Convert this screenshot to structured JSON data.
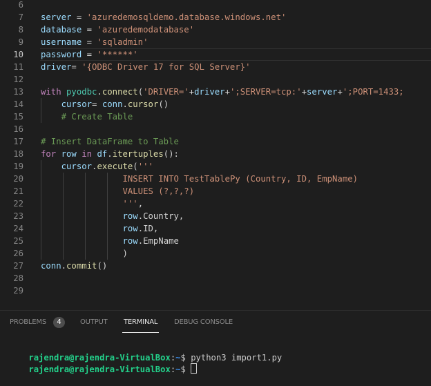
{
  "editor": {
    "active_line": 10,
    "lines": [
      {
        "n": "6",
        "tokens": []
      },
      {
        "n": "7",
        "tokens": [
          {
            "t": "server",
            "c": "var"
          },
          {
            "t": " = ",
            "c": "op"
          },
          {
            "t": "'azuredemosqldemo.database.windows.net'",
            "c": "str"
          }
        ]
      },
      {
        "n": "8",
        "tokens": [
          {
            "t": "database",
            "c": "var"
          },
          {
            "t": " = ",
            "c": "op"
          },
          {
            "t": "'azuredemodatabase'",
            "c": "str"
          }
        ]
      },
      {
        "n": "9",
        "tokens": [
          {
            "t": "username",
            "c": "var"
          },
          {
            "t": " = ",
            "c": "op"
          },
          {
            "t": "'sqladmin'",
            "c": "str"
          }
        ]
      },
      {
        "n": "10",
        "tokens": [
          {
            "t": "password",
            "c": "var"
          },
          {
            "t": " = ",
            "c": "op"
          },
          {
            "t": "'******'",
            "c": "str"
          }
        ]
      },
      {
        "n": "11",
        "tokens": [
          {
            "t": "driver",
            "c": "var"
          },
          {
            "t": "= ",
            "c": "op"
          },
          {
            "t": "'{ODBC Driver 17 for SQL Server}'",
            "c": "str"
          }
        ]
      },
      {
        "n": "12",
        "tokens": []
      },
      {
        "n": "13",
        "tokens": [
          {
            "t": "with ",
            "c": "kw"
          },
          {
            "t": "pyodbc",
            "c": "fn"
          },
          {
            "t": ".",
            "c": "op"
          },
          {
            "t": "connect",
            "c": "meth"
          },
          {
            "t": "(",
            "c": "op"
          },
          {
            "t": "'DRIVER='",
            "c": "str"
          },
          {
            "t": "+",
            "c": "op"
          },
          {
            "t": "driver",
            "c": "var"
          },
          {
            "t": "+",
            "c": "op"
          },
          {
            "t": "';SERVER=tcp:'",
            "c": "str"
          },
          {
            "t": "+",
            "c": "op"
          },
          {
            "t": "server",
            "c": "var"
          },
          {
            "t": "+",
            "c": "op"
          },
          {
            "t": "';PORT=1433;",
            "c": "str"
          }
        ]
      },
      {
        "n": "14",
        "tokens": [
          {
            "t": "    ",
            "c": "op"
          },
          {
            "t": "cursor",
            "c": "var"
          },
          {
            "t": "= ",
            "c": "op"
          },
          {
            "t": "conn",
            "c": "var"
          },
          {
            "t": ".",
            "c": "op"
          },
          {
            "t": "cursor",
            "c": "meth"
          },
          {
            "t": "()",
            "c": "op"
          }
        ]
      },
      {
        "n": "15",
        "tokens": [
          {
            "t": "    ",
            "c": "op"
          },
          {
            "t": "# Create Table",
            "c": "com"
          }
        ]
      },
      {
        "n": "16",
        "tokens": []
      },
      {
        "n": "17",
        "tokens": [
          {
            "t": "# Insert DataFrame to Table",
            "c": "com"
          }
        ]
      },
      {
        "n": "18",
        "tokens": [
          {
            "t": "for ",
            "c": "kw"
          },
          {
            "t": "row",
            "c": "var"
          },
          {
            "t": " in ",
            "c": "kw"
          },
          {
            "t": "df",
            "c": "var"
          },
          {
            "t": ".",
            "c": "op"
          },
          {
            "t": "itertuples",
            "c": "meth"
          },
          {
            "t": "():",
            "c": "op"
          }
        ]
      },
      {
        "n": "19",
        "tokens": [
          {
            "t": "    ",
            "c": "op"
          },
          {
            "t": "cursor",
            "c": "var"
          },
          {
            "t": ".",
            "c": "op"
          },
          {
            "t": "execute",
            "c": "meth"
          },
          {
            "t": "(",
            "c": "op"
          },
          {
            "t": "'''",
            "c": "str"
          }
        ]
      },
      {
        "n": "20",
        "tokens": [
          {
            "t": "                ",
            "c": "op"
          },
          {
            "t": "INSERT INTO TestTablePy (Country, ID, EmpName)",
            "c": "str"
          }
        ]
      },
      {
        "n": "21",
        "tokens": [
          {
            "t": "                ",
            "c": "op"
          },
          {
            "t": "VALUES (?,?,?)",
            "c": "str"
          }
        ]
      },
      {
        "n": "22",
        "tokens": [
          {
            "t": "                ",
            "c": "op"
          },
          {
            "t": "'''",
            "c": "str"
          },
          {
            "t": ",",
            "c": "op"
          }
        ]
      },
      {
        "n": "23",
        "tokens": [
          {
            "t": "                ",
            "c": "op"
          },
          {
            "t": "row",
            "c": "var"
          },
          {
            "t": ".Country,",
            "c": "op"
          }
        ]
      },
      {
        "n": "24",
        "tokens": [
          {
            "t": "                ",
            "c": "op"
          },
          {
            "t": "row",
            "c": "var"
          },
          {
            "t": ".ID,",
            "c": "op"
          }
        ]
      },
      {
        "n": "25",
        "tokens": [
          {
            "t": "                ",
            "c": "op"
          },
          {
            "t": "row",
            "c": "var"
          },
          {
            "t": ".EmpName",
            "c": "op"
          }
        ]
      },
      {
        "n": "26",
        "tokens": [
          {
            "t": "                ",
            "c": "op"
          },
          {
            "t": ")",
            "c": "op"
          }
        ]
      },
      {
        "n": "27",
        "tokens": [
          {
            "t": "conn",
            "c": "var"
          },
          {
            "t": ".",
            "c": "op"
          },
          {
            "t": "commit",
            "c": "meth"
          },
          {
            "t": "()",
            "c": "op"
          }
        ]
      },
      {
        "n": "28",
        "tokens": []
      },
      {
        "n": "29",
        "tokens": []
      }
    ]
  },
  "panel": {
    "tabs": {
      "problems": "PROBLEMS",
      "problems_count": "4",
      "output": "OUTPUT",
      "terminal": "TERMINAL",
      "debug_console": "DEBUG CONSOLE"
    },
    "active_tab": "TERMINAL",
    "terminal": {
      "lines": [
        {
          "user": "rajendra@rajendra-VirtualBox",
          "sep": ":",
          "path": "~",
          "dollar": "$ ",
          "cmd": "python3 import1.py"
        },
        {
          "user": "rajendra@rajendra-VirtualBox",
          "sep": ":",
          "path": "~",
          "dollar": "$ ",
          "cmd": ""
        }
      ]
    }
  }
}
